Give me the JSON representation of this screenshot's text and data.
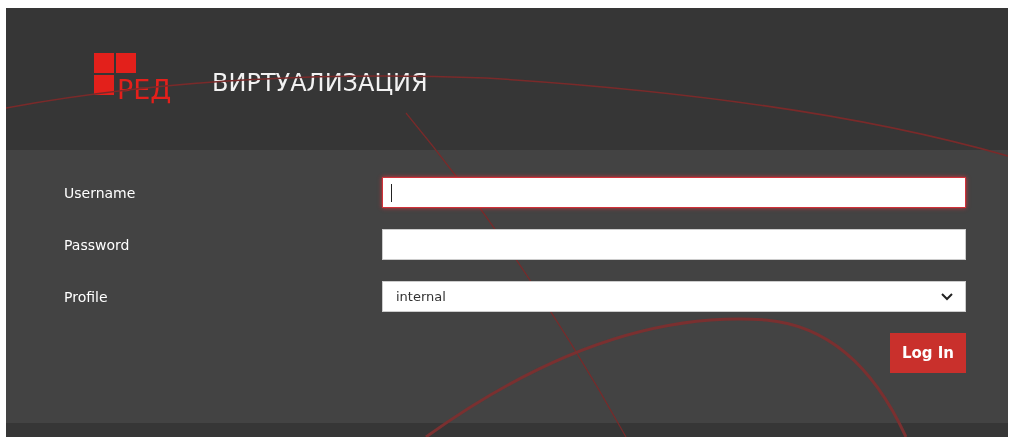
{
  "header": {
    "logo_text": "РЕД",
    "title": "ВИРТУАЛИЗАЦИЯ"
  },
  "fields": [
    {
      "kind": "text",
      "label": "Username",
      "focused": true
    },
    {
      "kind": "password",
      "label": "Password",
      "focused": false
    },
    {
      "kind": "select",
      "label": "Profile",
      "value": "internal",
      "focused": false
    }
  ],
  "buttons": [
    "Log In"
  ]
}
